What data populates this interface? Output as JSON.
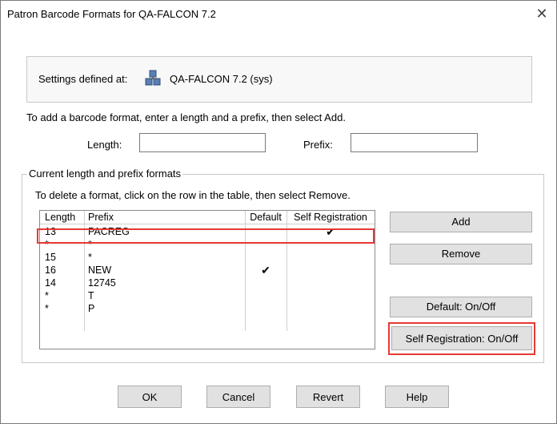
{
  "window": {
    "title": "Patron Barcode Formats for QA-FALCON 7.2",
    "close_glyph": "✕"
  },
  "settings": {
    "label": "Settings defined at:",
    "value": "QA-FALCON 7.2 (sys)",
    "icon": "server-icon"
  },
  "add_section": {
    "info": "To add a barcode format, enter a length and a prefix, then select Add.",
    "length_label": "Length:",
    "length_value": "",
    "prefix_label": "Prefix:",
    "prefix_value": ""
  },
  "formats": {
    "group_label": "Current length and prefix formats",
    "delete_info": "To delete a format, click on the row in the table, then select Remove.",
    "columns": {
      "length": "Length",
      "prefix": "Prefix",
      "default": "Default",
      "self_registration": "Self Registration"
    },
    "rows": [
      {
        "length": "13",
        "prefix": "PACREG",
        "default": "",
        "self_registration": "✔"
      },
      {
        "length": "*",
        "prefix": "*",
        "default": "",
        "self_registration": ""
      },
      {
        "length": "15",
        "prefix": "*",
        "default": "",
        "self_registration": ""
      },
      {
        "length": "16",
        "prefix": "NEW",
        "default": "✔",
        "self_registration": ""
      },
      {
        "length": "14",
        "prefix": "12745",
        "default": "",
        "self_registration": ""
      },
      {
        "length": "*",
        "prefix": "T",
        "default": "",
        "self_registration": ""
      },
      {
        "length": "*",
        "prefix": "P",
        "default": "",
        "self_registration": ""
      }
    ]
  },
  "side_buttons": {
    "add": "Add",
    "remove": "Remove",
    "default_toggle": "Default: On/Off",
    "self_reg_toggle": "Self Registration: On/Off"
  },
  "footer_buttons": {
    "ok": "OK",
    "cancel": "Cancel",
    "revert": "Revert",
    "help": "Help"
  },
  "colors": {
    "highlight": "#e53935",
    "button_face": "#e1e1e1"
  }
}
